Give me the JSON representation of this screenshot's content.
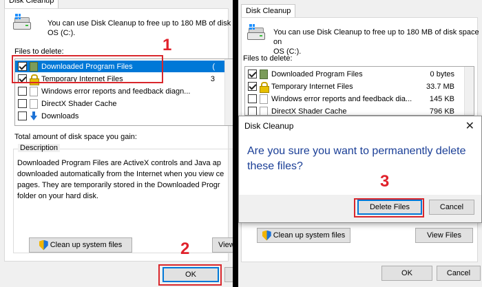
{
  "left": {
    "tab_label": "Disk Cleanup",
    "intro_text_1": "You can use Disk Cleanup to free up to 180 MB of disk",
    "intro_text_2": "OS (C:).",
    "files_label": "Files to delete:",
    "files": [
      {
        "name": "Downloaded Program Files",
        "size": "(",
        "checked": true,
        "selected": true,
        "icon": "package-icon"
      },
      {
        "name": "Temporary Internet Files",
        "size": "3",
        "checked": true,
        "selected": false,
        "icon": "lock-icon"
      },
      {
        "name": "Windows error reports and feedback diagn...",
        "size": "",
        "checked": false,
        "selected": false,
        "icon": "page-icon"
      },
      {
        "name": "DirectX Shader Cache",
        "size": "",
        "checked": false,
        "selected": false,
        "icon": "page-icon"
      },
      {
        "name": "Downloads",
        "size": "",
        "checked": false,
        "selected": false,
        "icon": "download-arrow-icon"
      }
    ],
    "total_label": "Total amount of disk space you gain:",
    "description_title": "Description",
    "description_lines": [
      "Downloaded Program Files are ActiveX controls and Java ap",
      "downloaded automatically from the Internet when you view ce",
      "pages. They are temporarily stored in the Downloaded Progr",
      "folder on your hard disk."
    ],
    "cleanup_button": "Clean up system files",
    "view_files_button": "View F",
    "ok_button": "OK"
  },
  "right": {
    "tab_label": "Disk Cleanup",
    "intro_text_1": "You can use Disk Cleanup to free up to 180 MB of disk space on",
    "intro_text_2": "OS (C:).",
    "files_label": "Files to delete:",
    "files": [
      {
        "name": "Downloaded Program Files",
        "size": "0 bytes",
        "checked": true,
        "icon": "package-icon"
      },
      {
        "name": "Temporary Internet Files",
        "size": "33.7 MB",
        "checked": true,
        "icon": "lock-icon"
      },
      {
        "name": "Windows error reports and feedback dia...",
        "size": "145 KB",
        "checked": false,
        "icon": "page-icon"
      },
      {
        "name": "DirectX Shader Cache",
        "size": "796 KB",
        "checked": false,
        "icon": "page-icon"
      }
    ],
    "dialog": {
      "title": "Disk Cleanup",
      "close_glyph": "✕",
      "question": "Are you sure you want to permanently delete these files?",
      "delete_button": "Delete Files",
      "cancel_button": "Cancel"
    },
    "cleanup_button": "Clean up system files",
    "view_files_button": "View Files",
    "ok_button": "OK",
    "cancel_button": "Cancel"
  },
  "steps": {
    "one": "1",
    "two": "2",
    "three": "3"
  },
  "colors": {
    "accent": "#0078d7",
    "highlight_red": "#d9262b",
    "step_red": "#e0212b",
    "question_blue": "#1a3e96"
  }
}
